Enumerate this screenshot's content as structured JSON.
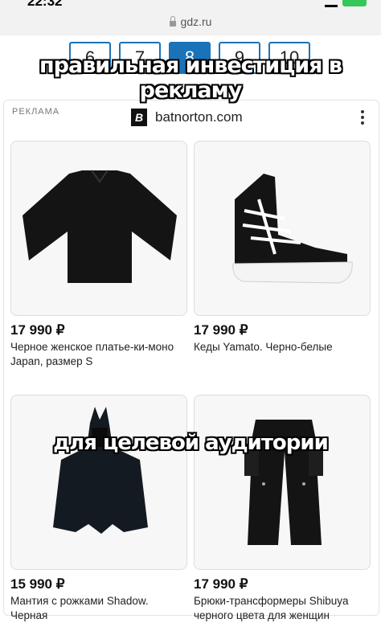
{
  "status": {
    "time": "22:32"
  },
  "browser": {
    "url": "gdz.ru"
  },
  "pagination": {
    "pages": [
      "6",
      "7",
      "8",
      "9",
      "10"
    ],
    "active_page": "8"
  },
  "captions": {
    "top": "правильная инвестиция в рекламу",
    "middle": "для целевой аудитории"
  },
  "ad": {
    "label": "РЕКЛАМА",
    "domain": "batnorton.com",
    "logo_letter": "B",
    "products": [
      {
        "price": "17 990 ₽",
        "title": "Черное женское платье-ки-моно Japan, размер S",
        "icon": "kimono-dress-image"
      },
      {
        "price": "17 990 ₽",
        "title": "Кеды Yamato. Черно-белые",
        "icon": "high-top-sneaker-image"
      },
      {
        "price": "15 990 ₽",
        "title": "Мантия с рожками Shadow. Черная",
        "icon": "horned-cloak-image"
      },
      {
        "price": "17 990 ₽",
        "title": "Брюки-трансформеры Shibuya черного цвета для женщин",
        "icon": "cargo-pants-image"
      }
    ]
  }
}
